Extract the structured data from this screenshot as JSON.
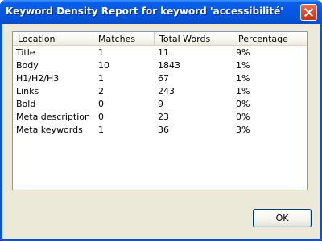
{
  "window": {
    "title": "Keyword Density Report for keyword 'accessibilité'"
  },
  "icons": {
    "close": "close-icon"
  },
  "table": {
    "columns": [
      "Location",
      "Matches",
      "Total Words",
      "Percentage"
    ],
    "rows": [
      {
        "location": "Title",
        "matches": "1",
        "total_words": "11",
        "percentage": "9%"
      },
      {
        "location": "Body",
        "matches": "10",
        "total_words": "1843",
        "percentage": "1%"
      },
      {
        "location": "H1/H2/H3",
        "matches": "1",
        "total_words": "67",
        "percentage": "1%"
      },
      {
        "location": "Links",
        "matches": "2",
        "total_words": "243",
        "percentage": "1%"
      },
      {
        "location": "Bold",
        "matches": "0",
        "total_words": "9",
        "percentage": "0%"
      },
      {
        "location": "Meta description",
        "matches": "0",
        "total_words": "23",
        "percentage": "0%"
      },
      {
        "location": "Meta keywords",
        "matches": "1",
        "total_words": "36",
        "percentage": "3%"
      }
    ]
  },
  "buttons": {
    "ok_label": "OK"
  },
  "colors": {
    "titlebar": "#0653d8",
    "dialog_face": "#ece9d8",
    "close_button": "#d74c2c",
    "list_border": "#7f9db9"
  }
}
